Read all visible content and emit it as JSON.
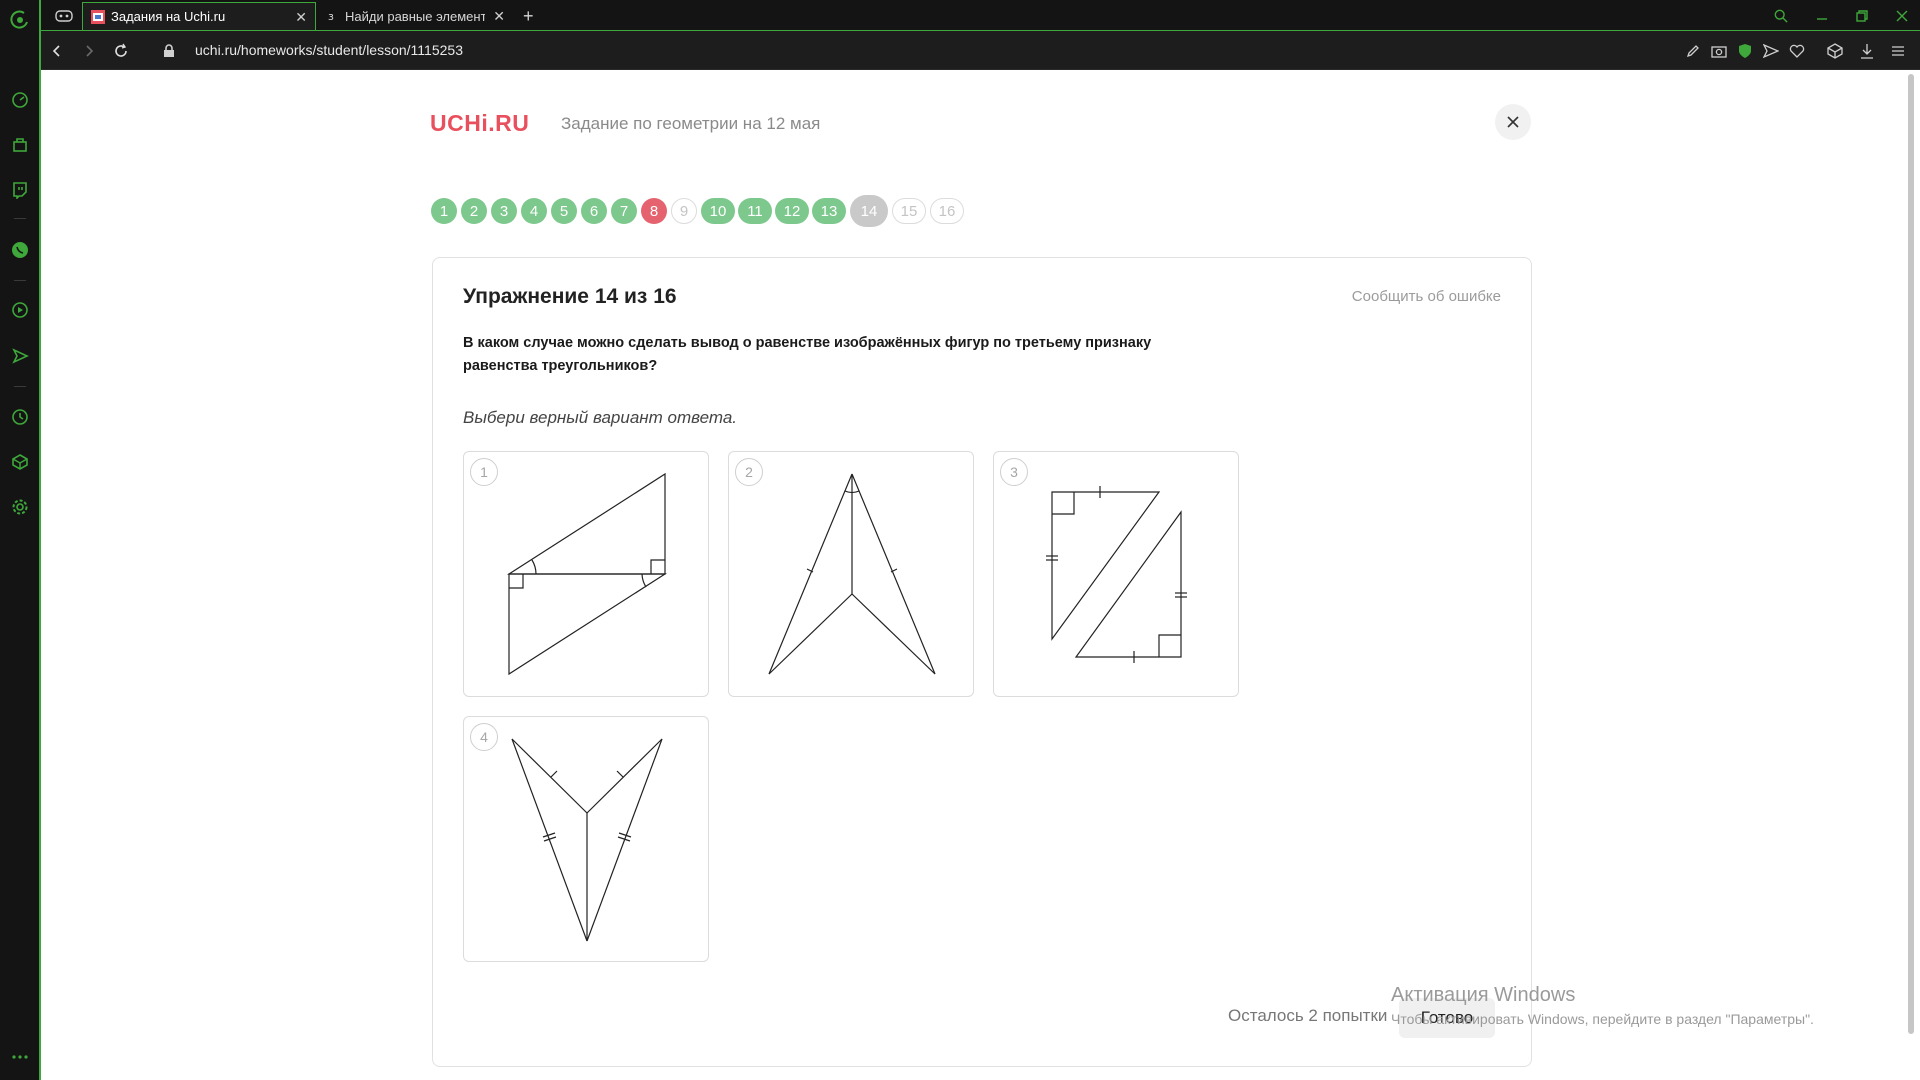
{
  "browser": {
    "tabs": [
      {
        "title": "Задания на Uchi.ru",
        "active": true
      },
      {
        "title": "Найди равные элементы",
        "active": false
      }
    ],
    "url": "uchi.ru/homeworks/student/lesson/1115253"
  },
  "header": {
    "logo": "UCHi.RU",
    "title": "Задание по геометрии на 12 мая"
  },
  "progress": [
    {
      "label": "1",
      "state": "done"
    },
    {
      "label": "2",
      "state": "done"
    },
    {
      "label": "3",
      "state": "done"
    },
    {
      "label": "4",
      "state": "done"
    },
    {
      "label": "5",
      "state": "done"
    },
    {
      "label": "6",
      "state": "done"
    },
    {
      "label": "7",
      "state": "done"
    },
    {
      "label": "8",
      "state": "wrong"
    },
    {
      "label": "9",
      "state": "skipped"
    },
    {
      "label": "10",
      "state": "done"
    },
    {
      "label": "11",
      "state": "done"
    },
    {
      "label": "12",
      "state": "done"
    },
    {
      "label": "13",
      "state": "done"
    },
    {
      "label": "14",
      "state": "current"
    },
    {
      "label": "15",
      "state": "pending"
    },
    {
      "label": "16",
      "state": "pending"
    }
  ],
  "exercise": {
    "title": "Упражнение 14 из 16",
    "report": "Сообщить об ошибке",
    "question": "В каком случае можно сделать вывод о равенстве изображённых фигур по третьему признаку равенства треугольников?",
    "hint": "Выбери верный вариант ответа.",
    "options": [
      {
        "number": "1"
      },
      {
        "number": "2"
      },
      {
        "number": "3"
      },
      {
        "number": "4"
      }
    ],
    "attempts": "Осталось 2 попытки",
    "submit": "Готово"
  },
  "watermark": {
    "line1": "Активация Windows",
    "line2": "Чтобы активировать Windows, перейдите в раздел \"Параметры\"."
  },
  "colors": {
    "accent": "#3ea83a",
    "done": "#7dc88c",
    "wrong": "#e5636e",
    "logo": "#e9505d"
  }
}
